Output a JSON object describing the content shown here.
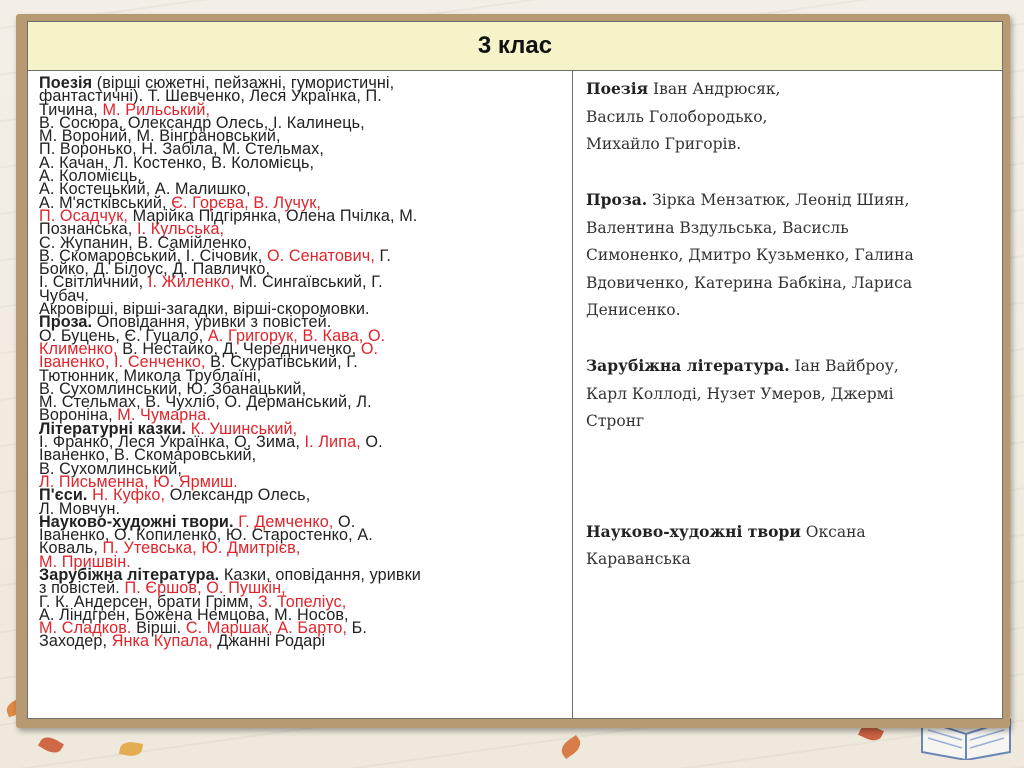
{
  "slide": {
    "title": "3 клас"
  },
  "left": {
    "lines": [
      [
        {
          "t": "Поезія",
          "s": "b"
        },
        {
          "t": " (вірші сюжетні, пейзажні, гумористичні,"
        }
      ],
      [
        {
          "t": "фантастичні).   Т. Шевченко,   Леся Українка, П."
        }
      ],
      [
        {
          "t": "Тичина, "
        },
        {
          "t": "М. Рильський,",
          "s": "red"
        }
      ],
      [
        {
          "t": "В. Сосюра, Олександр Олесь, І. Калинець,"
        }
      ],
      [
        {
          "t": "М. Вороний, М. Вінграновський,"
        }
      ],
      [
        {
          "t": "П. Воронько, Н. Забіла, М. Стельмах,"
        }
      ],
      [
        {
          "t": "А. Качан, Л. Костенко, В. Коломієць,"
        }
      ],
      [
        {
          "t": "А. Коломієць,"
        }
      ],
      [
        {
          "t": "А. Костецький, А. Малишко,"
        }
      ],
      [
        {
          "t": " А. М'ястківський, "
        },
        {
          "t": "Є. Горєва, В. Лучук,",
          "s": "red"
        }
      ],
      [
        {
          "t": " П. Осадчук,",
          "s": "red"
        },
        {
          "t": " Марійка Підгірянка, Олена Пчілка, М."
        }
      ],
      [
        {
          "t": "Познанська, "
        },
        {
          "t": "І. Кульська,",
          "s": "red"
        }
      ],
      [
        {
          "t": " С. Жупанин,  В. Самійленко,"
        }
      ],
      [
        {
          "t": "В. Скомаровський, І. Січовик, "
        },
        {
          "t": "О. Сенатович,",
          "s": "red"
        },
        {
          "t": " Г."
        }
      ],
      [
        {
          "t": "Бойко, Д. Білоус, Д. Павличко,"
        }
      ],
      [
        {
          "t": "І. Світличний, "
        },
        {
          "t": "І. Жиленко,",
          "s": "red"
        },
        {
          "t": " М. Сингаївський, Г."
        }
      ],
      [
        {
          "t": "Чубач."
        }
      ],
      [
        {
          "t": "Акровірші, вірші-загадки, вірші-скоромовки."
        }
      ],
      [
        {
          "t": "Проза.",
          "s": "b"
        },
        {
          "t": "   Оповідання, уривки  з повістей."
        }
      ],
      [
        {
          "t": "О. Буцень, Є. Гуцало, "
        },
        {
          "t": "А. Григорук, В. Кава, О.",
          "s": "red"
        }
      ],
      [
        {
          "t": "Клименко,",
          "s": "red"
        },
        {
          "t": " В. Нестайко, Д. Чередниченко, "
        },
        {
          "t": "О.",
          "s": "red"
        }
      ],
      [
        {
          "t": "Іваненко, І. Сенченко,",
          "s": "red"
        },
        {
          "t": " В. Скуратівський, Г."
        }
      ],
      [
        {
          "t": "Тютюнник, Микола Трублаїні,"
        }
      ],
      [
        {
          "t": " В. Сухомлинський, Ю. Збанацький,"
        }
      ],
      [
        {
          "t": "М. Стельмах, В. Чухліб,   О. Дерманський,   Л."
        }
      ],
      [
        {
          "t": "Вороніна, "
        },
        {
          "t": "М. Чумарна.",
          "s": "red"
        }
      ],
      [
        {
          "t": "Літературні казки.",
          "s": "b"
        },
        {
          "t": " "
        },
        {
          "t": "К. Ушинський,",
          "s": "red"
        }
      ],
      [
        {
          "t": "І. Франко, Леся Українка, О. Зима, "
        },
        {
          "t": "І. Липа,",
          "s": "red"
        },
        {
          "t": " О."
        }
      ],
      [
        {
          "t": "Іваненко,  В. Скомаровський,"
        }
      ],
      [
        {
          "t": "В. Сухомлинський,"
        }
      ],
      [
        {
          "t": "Л. Письменна, Ю. Ярмиш.",
          "s": "red"
        }
      ],
      [
        {
          "t": "П'єси.",
          "s": "b"
        },
        {
          "t": " "
        },
        {
          "t": "Н. Куфко,",
          "s": "red"
        },
        {
          "t": " Олександр Олесь,"
        }
      ],
      [
        {
          "t": "Л. Мовчун."
        }
      ],
      [
        {
          "t": "Науково-художні   твори.",
          "s": "b"
        },
        {
          "t": "    "
        },
        {
          "t": "Г. Демченко,",
          "s": "red"
        },
        {
          "t": " О."
        }
      ],
      [
        {
          "t": "Іваненко, О. Копиленко, Ю. Старостенко, А."
        }
      ],
      [
        {
          "t": "Коваль,  "
        },
        {
          "t": "П. Утевська,  Ю. Дмитрієв,",
          "s": "red"
        }
      ],
      [
        {
          "t": "М. Пришвін.",
          "s": "red"
        }
      ],
      [
        {
          "t": "Зарубіжна література.",
          "s": "b"
        },
        {
          "t": " Казки, оповідання, уривки"
        }
      ],
      [
        {
          "t": "з повістей. "
        },
        {
          "t": "П. Єршов, О. Пушкін,",
          "s": "red"
        }
      ],
      [
        {
          "t": "Г. К. Андерсен, брати Грімм, "
        },
        {
          "t": "З. Топеліус,",
          "s": "red"
        }
      ],
      [
        {
          "t": "А. Ліндгрен, Божена Немцова, М. Носов,"
        }
      ],
      [
        {
          "t": "М. Сладков.",
          "s": "red"
        },
        {
          "t": " Вірші.  "
        },
        {
          "t": "С. Маршак,  А. Барто,",
          "s": "red"
        },
        {
          "t": "    Б."
        }
      ],
      [
        {
          "t": "Заходер, "
        },
        {
          "t": "Янка Купала,",
          "s": "red"
        },
        {
          "t": " Джанні Родарі"
        }
      ]
    ]
  },
  "right": {
    "poetry_label": "Поезія",
    "poetry_1": " Іван Андрюсяк,",
    "poetry_2": "Василь Голобородько,",
    "poetry_3": "Михайло Григорів.",
    "prose_label": "Проза.",
    "prose_1": "  Зірка Мензатюк, Леонід Шиян,",
    "prose_2": "Валентина Вздульська, Васисль",
    "prose_3": "Симоненко, Дмитро Кузьменко, Галина",
    "prose_4": "Вдовиченко, Катерина Бабкіна, Лариса",
    "prose_5": "Денисенко.",
    "foreign_label": "Зарубіжна література.",
    "foreign_1": "  Іан Вайброу,",
    "foreign_2": "Карл Коллоді, Нузет Умеров, Джермі",
    "foreign_3": "Стронг",
    "science_label": "Науково-художні  твори",
    "science_1": " Оксана",
    "science_2": "Караванська"
  },
  "colors": {
    "frame": "#b79a72",
    "header_bg": "#f6f3c8",
    "accent_red": "#e0242b"
  }
}
